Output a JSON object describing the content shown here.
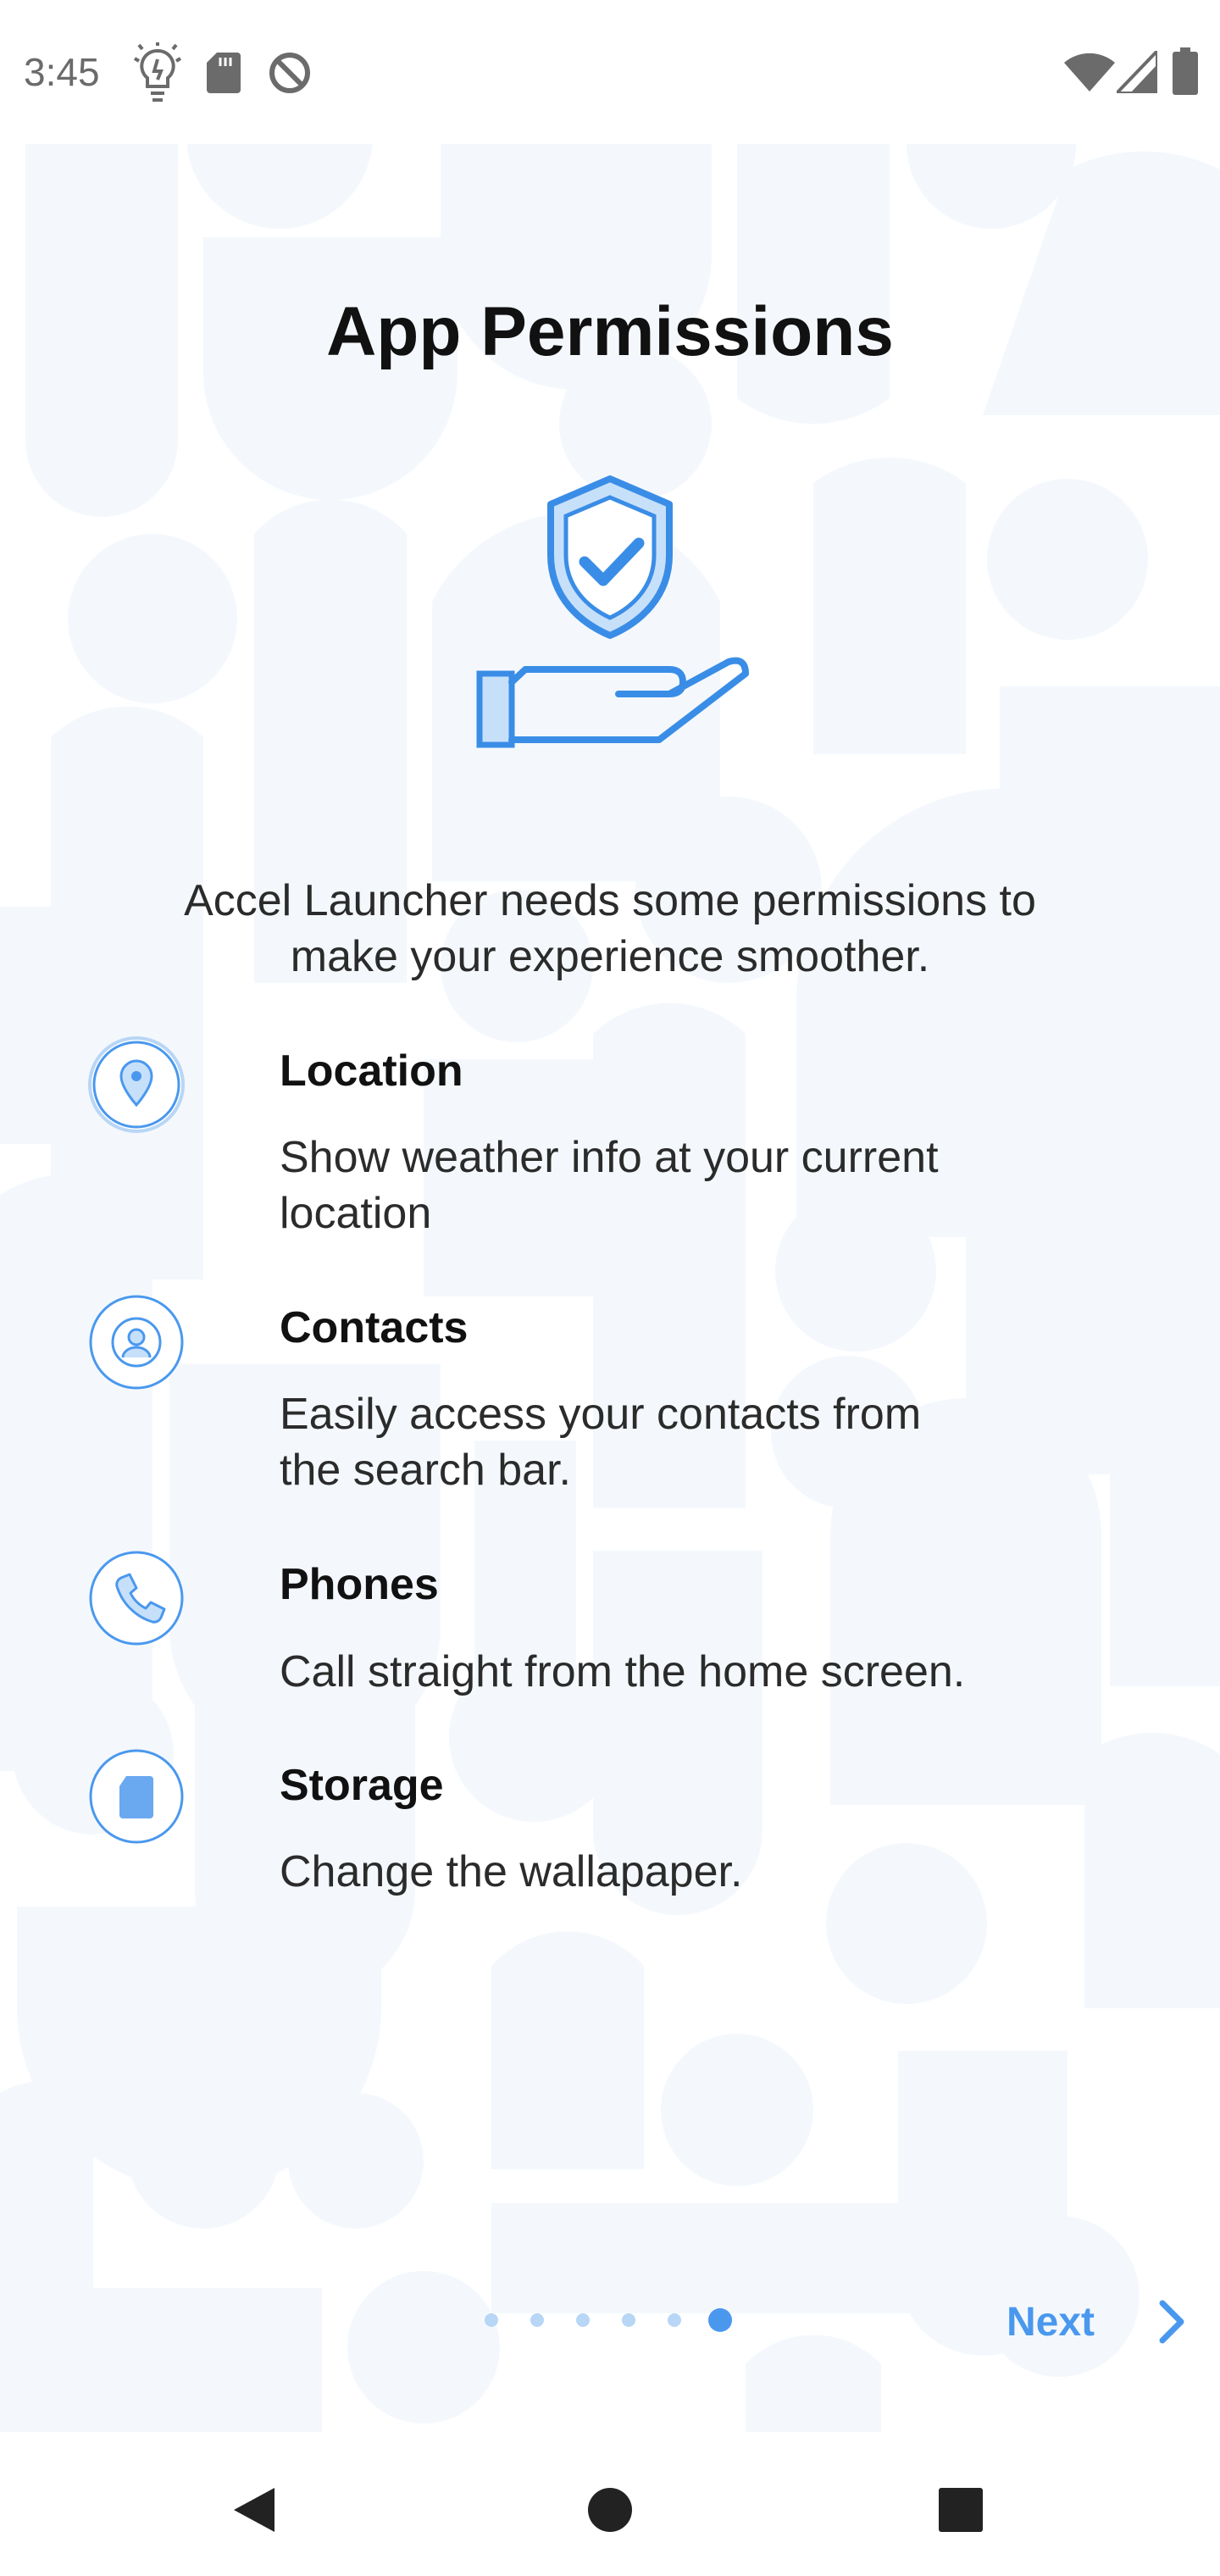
{
  "status_bar": {
    "time": "3:45",
    "left_icons": [
      "lightbulb-icon",
      "sd-card-icon",
      "do-not-disturb-icon"
    ],
    "right_icons": [
      "wifi-icon",
      "cell-signal-icon",
      "battery-icon"
    ]
  },
  "page": {
    "title": "App Permissions",
    "illustration_icon": "shield-in-hand-icon",
    "intro_line1": "Accel Launcher needs some permissions to",
    "intro_line2": "make your experience smoother."
  },
  "permissions": [
    {
      "icon": "location-pin-icon",
      "title": "Location",
      "desc_line1": "Show weather info at your current",
      "desc_line2": "location"
    },
    {
      "icon": "contact-person-icon",
      "title": "Contacts",
      "desc_line1": "Easily access your contacts from",
      "desc_line2": "the search bar."
    },
    {
      "icon": "phone-icon",
      "title": "Phones",
      "desc_line1": "Call straight from the home screen.",
      "desc_line2": ""
    },
    {
      "icon": "storage-card-icon",
      "title": "Storage",
      "desc_line1": "Change the wallapaper.",
      "desc_line2": ""
    }
  ],
  "pager": {
    "count": 6,
    "active_index": 5
  },
  "next_button": {
    "label": "Next",
    "icon": "chevron-right-icon"
  },
  "nav_bar": {
    "icons": [
      "back-triangle-icon",
      "home-circle-icon",
      "recents-square-icon"
    ]
  },
  "colors": {
    "accent": "#4a98ee",
    "accent_light": "#c7e0fa",
    "pattern": "#f5f9fd"
  }
}
